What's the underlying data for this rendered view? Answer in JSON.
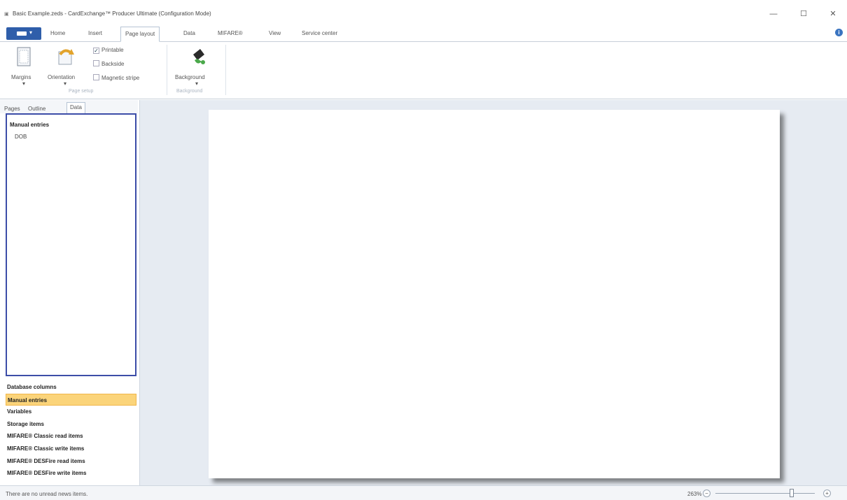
{
  "window": {
    "app_icon": "cardexchange-app-icon",
    "title": "Basic Example.zeds - CardExchange™ Producer Ultimate (Configuration Mode)",
    "minimize": "—",
    "maximize": "☐",
    "close": "✕"
  },
  "ribbon_tabs": [
    {
      "label": "Home"
    },
    {
      "label": "Insert"
    },
    {
      "label": "Page layout"
    },
    {
      "label": "Data"
    },
    {
      "label": "MIFARE®"
    },
    {
      "label": "View"
    },
    {
      "label": "Service center"
    }
  ],
  "active_tab": "Page layout",
  "help_icon": "i",
  "ribbon": {
    "page_setup": {
      "margins_label": "Margins",
      "orientation_label": "Orientation",
      "printable_label": "Printable",
      "printable_checked": true,
      "backside_label": "Backside",
      "backside_checked": false,
      "magnetic_stripe_label": "Magnetic stripe",
      "magnetic_stripe_checked": false,
      "group_label": "Page setup"
    },
    "background": {
      "background_label": "Background",
      "group_label": "Background"
    }
  },
  "side_tabs": [
    {
      "label": "Pages"
    },
    {
      "label": "Outline"
    },
    {
      "label": "Data"
    }
  ],
  "data_panel": {
    "heading": "Manual entries",
    "items": [
      "DOB"
    ]
  },
  "nav_items": [
    {
      "label": "Database columns",
      "selected": false
    },
    {
      "label": "Manual entries",
      "selected": true
    },
    {
      "label": "Variables",
      "selected": false
    },
    {
      "label": "Storage items",
      "selected": false
    },
    {
      "label": "MIFARE® Classic read items",
      "selected": false
    },
    {
      "label": "MIFARE® Classic write items",
      "selected": false
    },
    {
      "label": "MIFARE® DESFire read items",
      "selected": false
    },
    {
      "label": "MIFARE® DESFire write items",
      "selected": false
    }
  ],
  "status": {
    "news_text": "There are no unread news items.",
    "zoom_text": "263%",
    "zoom_out": "−",
    "zoom_in": "+"
  },
  "colors": {
    "file_button": "#2f5eaa",
    "data_panel_border": "#3c4da8",
    "selected_nav": "#fbd47a",
    "canvas_background": "#e6ebf2"
  }
}
